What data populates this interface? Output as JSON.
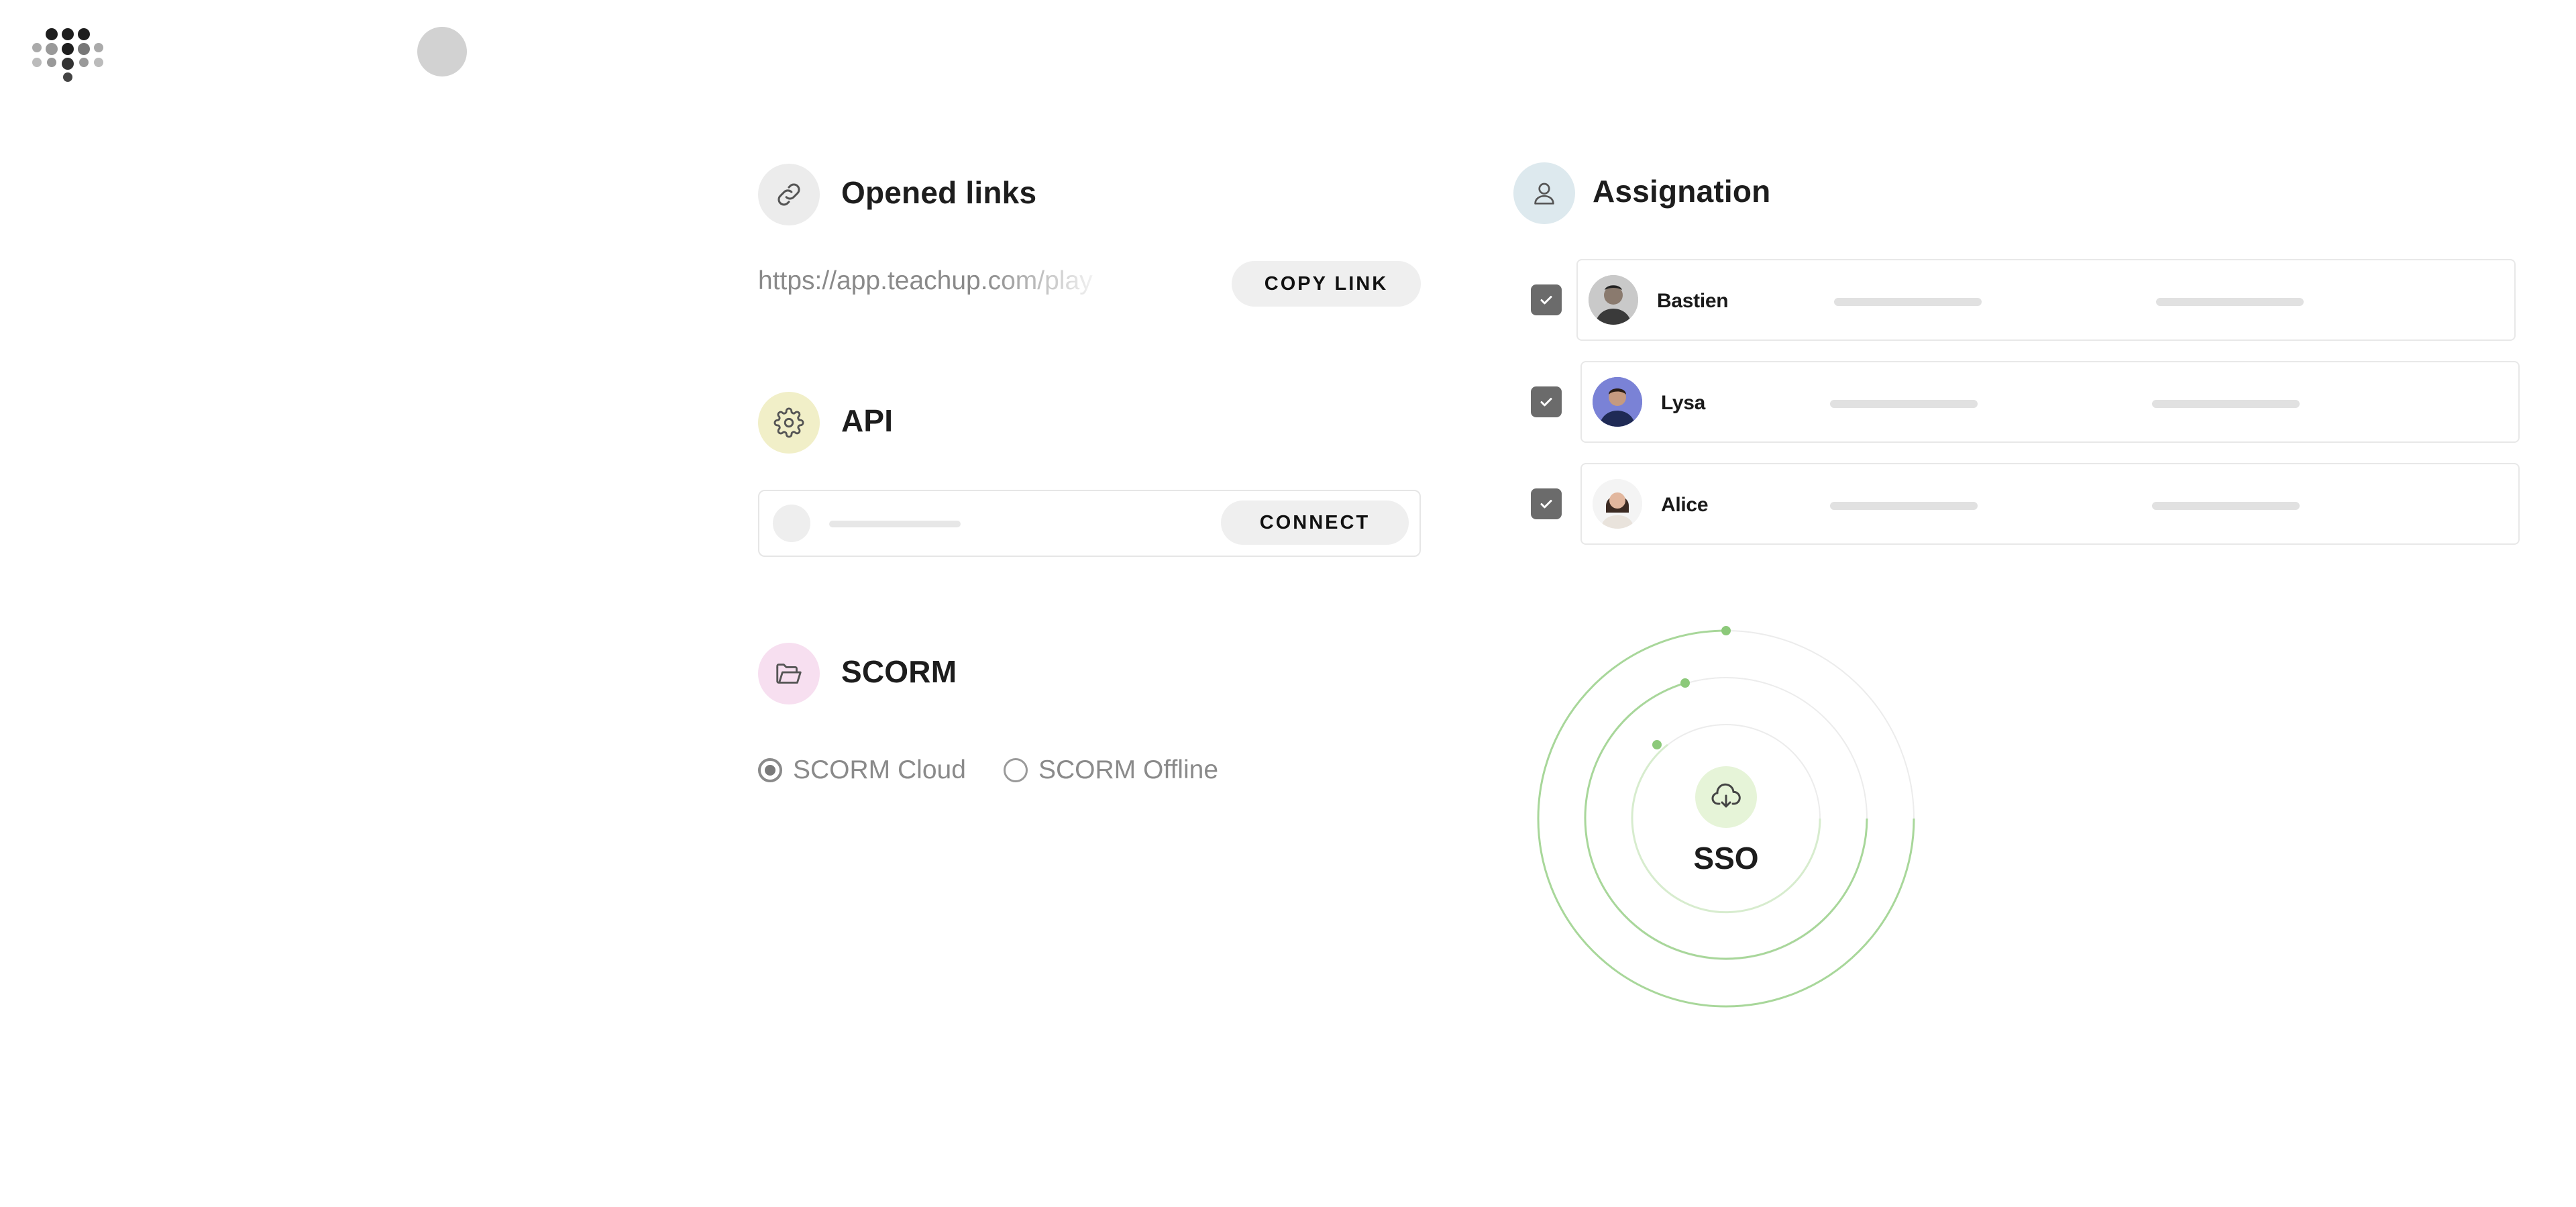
{
  "header": {
    "logo_icon": "dot-grid-logo",
    "avatar_icon": "user-avatar-placeholder"
  },
  "opened_links": {
    "title": "Opened links",
    "icon": "link-icon",
    "url": "https://app.teachup.com/play",
    "copy_button": "COPY LINK"
  },
  "api": {
    "title": "API",
    "icon": "gear-icon",
    "connect_button": "CONNECT"
  },
  "scorm": {
    "title": "SCORM",
    "icon": "folder-open-icon",
    "options": [
      {
        "label": "SCORM Cloud",
        "checked": true
      },
      {
        "label": "SCORM Offline",
        "checked": false
      }
    ]
  },
  "assignation": {
    "title": "Assignation",
    "icon": "user-icon",
    "rows": [
      {
        "name": "Bastien",
        "checked": true
      },
      {
        "name": "Lysa",
        "checked": true
      },
      {
        "name": "Alice",
        "checked": true
      }
    ]
  },
  "sso": {
    "label": "SSO",
    "icon": "cloud-download-icon"
  },
  "colors": {
    "accent_green": "#9ccf8a",
    "links_icon_bg": "#ececec",
    "api_icon_bg": "#f1efc8",
    "scorm_icon_bg": "#f7dff0",
    "assign_icon_bg": "#dde9ee",
    "sso_badge_bg": "#e6f4d8"
  }
}
